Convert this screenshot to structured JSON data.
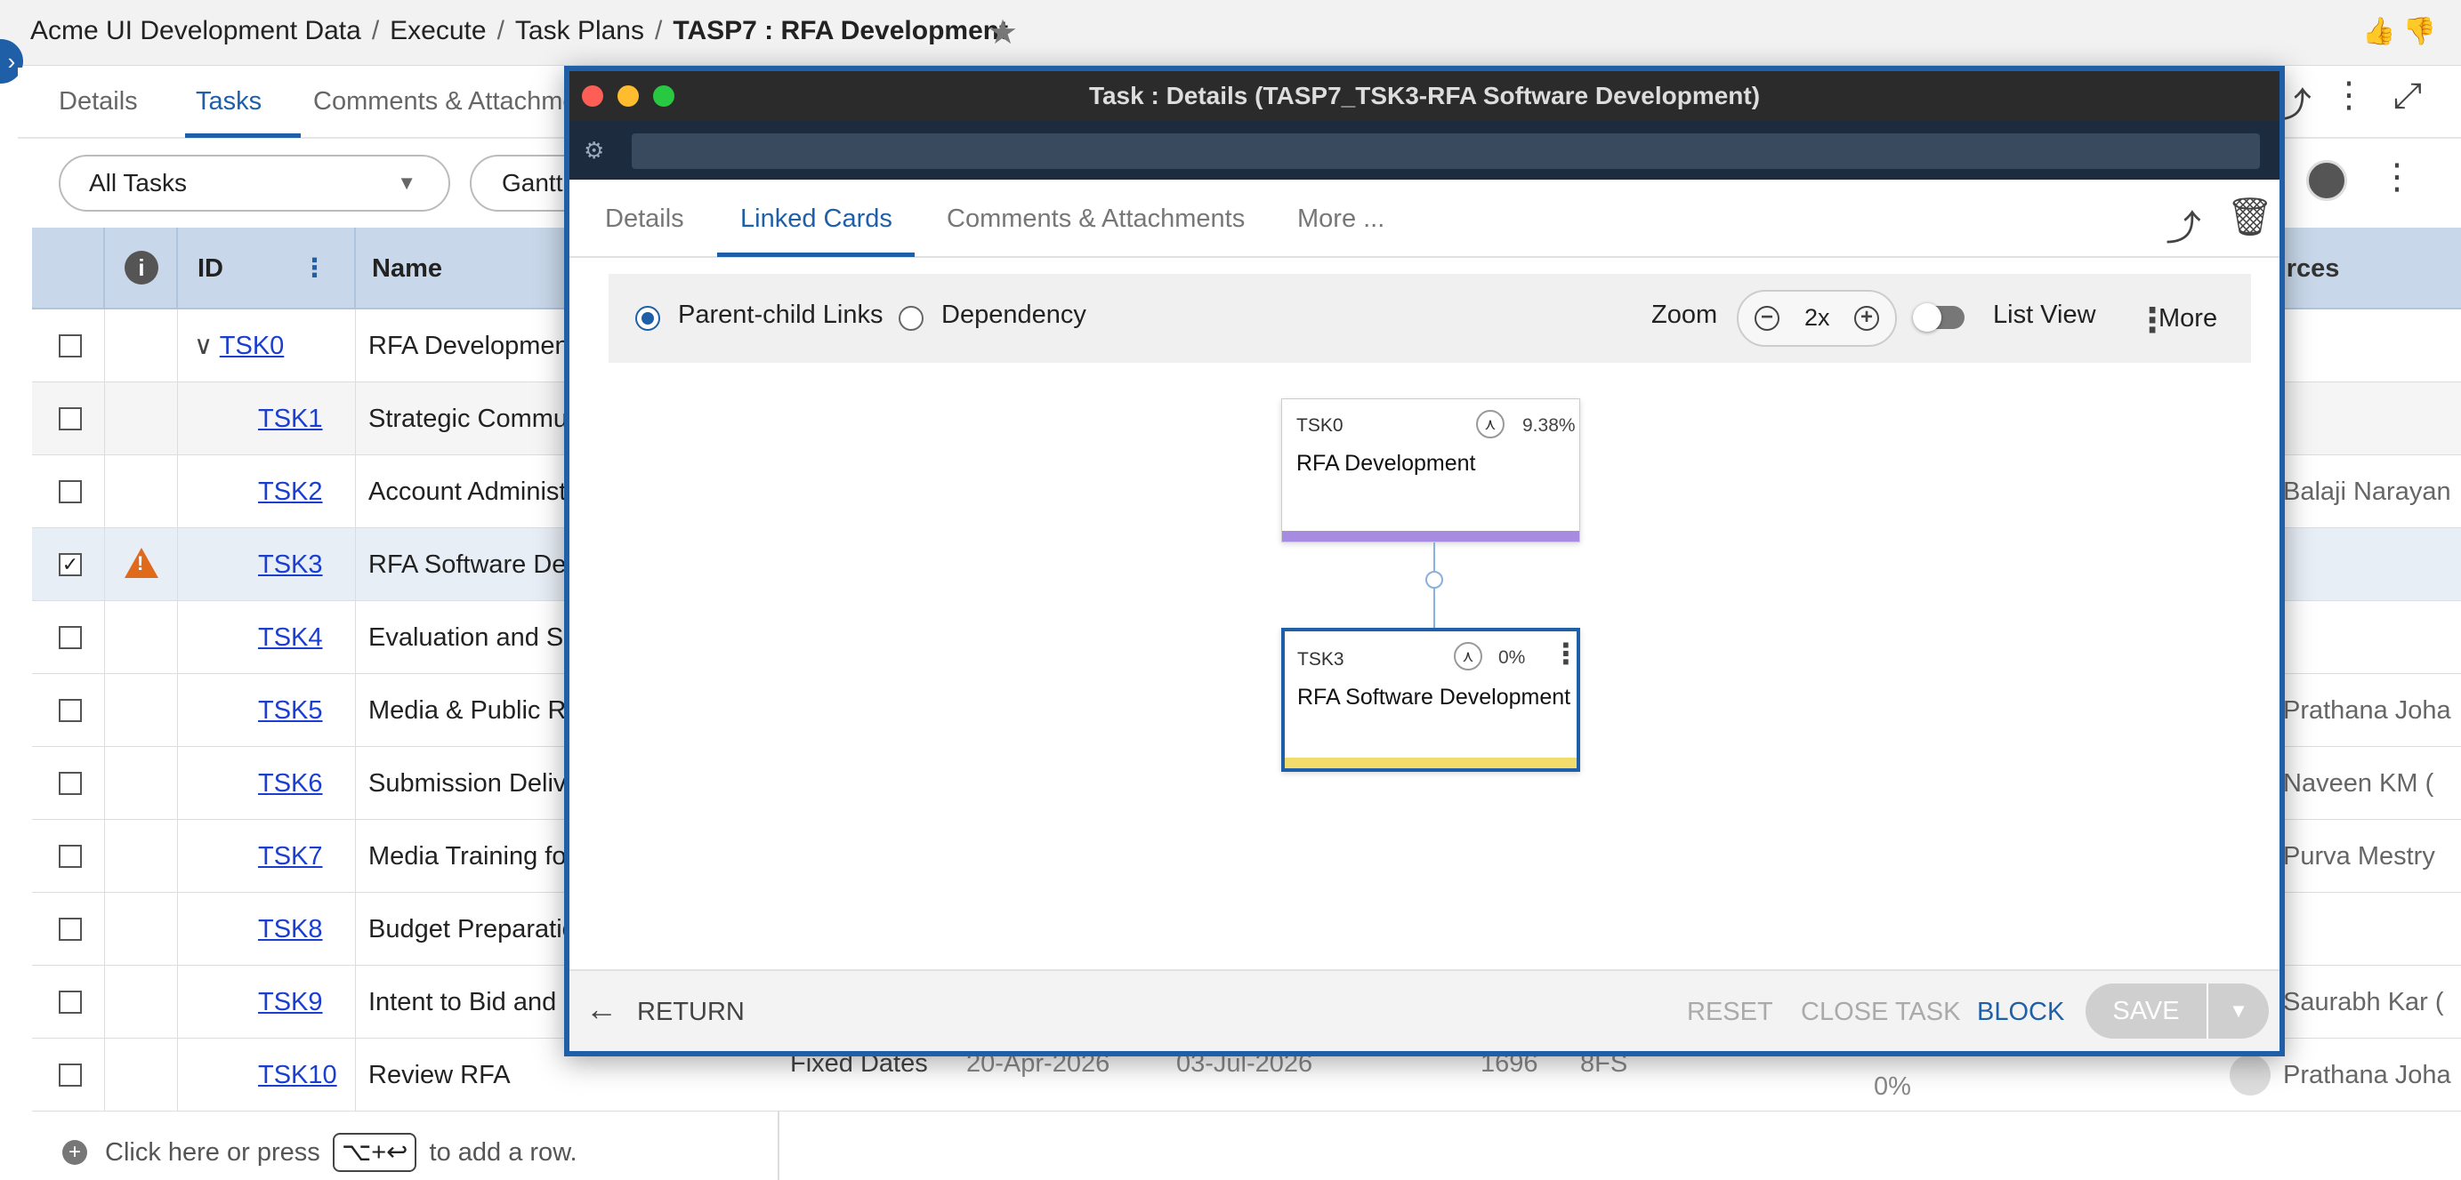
{
  "breadcrumb": {
    "items": [
      "Acme UI Development Data",
      "Execute",
      "Task Plans"
    ],
    "current": "TASP7 : RFA Development"
  },
  "main_tabs": [
    "Details",
    "Tasks",
    "Comments & Attachme"
  ],
  "filter": {
    "selected": "All Tasks",
    "view_button": "Gantt"
  },
  "grid": {
    "headers": {
      "id": "ID",
      "name": "Name",
      "resources": "urces"
    },
    "rows": [
      {
        "id": "TSK0",
        "name": "RFA Development",
        "resource": ""
      },
      {
        "id": "TSK1",
        "name": "Strategic Commun",
        "resource": ""
      },
      {
        "id": "TSK2",
        "name": "Account Administ",
        "resource": "Balaji Narayan"
      },
      {
        "id": "TSK3",
        "name": "RFA Software Dev",
        "resource": ""
      },
      {
        "id": "TSK4",
        "name": "Evaluation and Se",
        "resource": ""
      },
      {
        "id": "TSK5",
        "name": "Media & Public Re",
        "resource": "Prathana Joha"
      },
      {
        "id": "TSK6",
        "name": "Submission Delive",
        "resource": "Naveen KM ("
      },
      {
        "id": "TSK7",
        "name": "Media Training for",
        "resource": "Purva Mestry"
      },
      {
        "id": "TSK8",
        "name": "Budget Preparatio",
        "resource": ""
      },
      {
        "id": "TSK9",
        "name": "Intent to Bid and C",
        "resource": "Saurabh Kar ("
      },
      {
        "id": "TSK10",
        "name": "Review RFA",
        "resource": "Prathana Joha"
      }
    ],
    "last_row_extra": {
      "constraint": "Fixed Dates",
      "start": "20-Apr-2026",
      "finish": "03-Jul-2026",
      "hours": "1696",
      "pred": "8FS",
      "progress": "0%"
    },
    "add_row": {
      "before": "Click here or press",
      "shortcut": "⌥+↩",
      "after": "to add a row."
    }
  },
  "modal": {
    "title": "Task : Details (TASP7_TSK3-RFA Software Development)",
    "tabs": [
      "Details",
      "Linked Cards",
      "Comments & Attachments",
      "More ..."
    ],
    "toolbar": {
      "radio_parent": "Parent-child Links",
      "radio_dependency": "Dependency",
      "zoom_label": "Zoom",
      "zoom_value": "2x",
      "list_view": "List View",
      "more": "More"
    },
    "cards": [
      {
        "id": "TSK0",
        "name": "RFA Development",
        "percent": "9.38%",
        "bar_color": "#a78be0"
      },
      {
        "id": "TSK3",
        "name": "RFA Software Development",
        "percent": "0%",
        "bar_color": "#f2dc6b"
      }
    ],
    "footer": {
      "return": "RETURN",
      "reset": "RESET",
      "close_task": "CLOSE TASK",
      "block": "BLOCK",
      "save": "SAVE"
    }
  },
  "colors": {
    "accent": "#1f5fa8",
    "header_bg": "#c8d8ea",
    "warning": "#e06a1b"
  },
  "icons": [
    "star-icon",
    "thumbs-up-icon",
    "thumbs-down-icon",
    "share-icon",
    "more-vertical-icon",
    "expand-icon",
    "info-icon",
    "warning-icon",
    "trash-icon",
    "hierarchy-icon",
    "zoom-out-icon",
    "zoom-in-icon",
    "arrow-left-icon",
    "chevron-down-icon"
  ]
}
